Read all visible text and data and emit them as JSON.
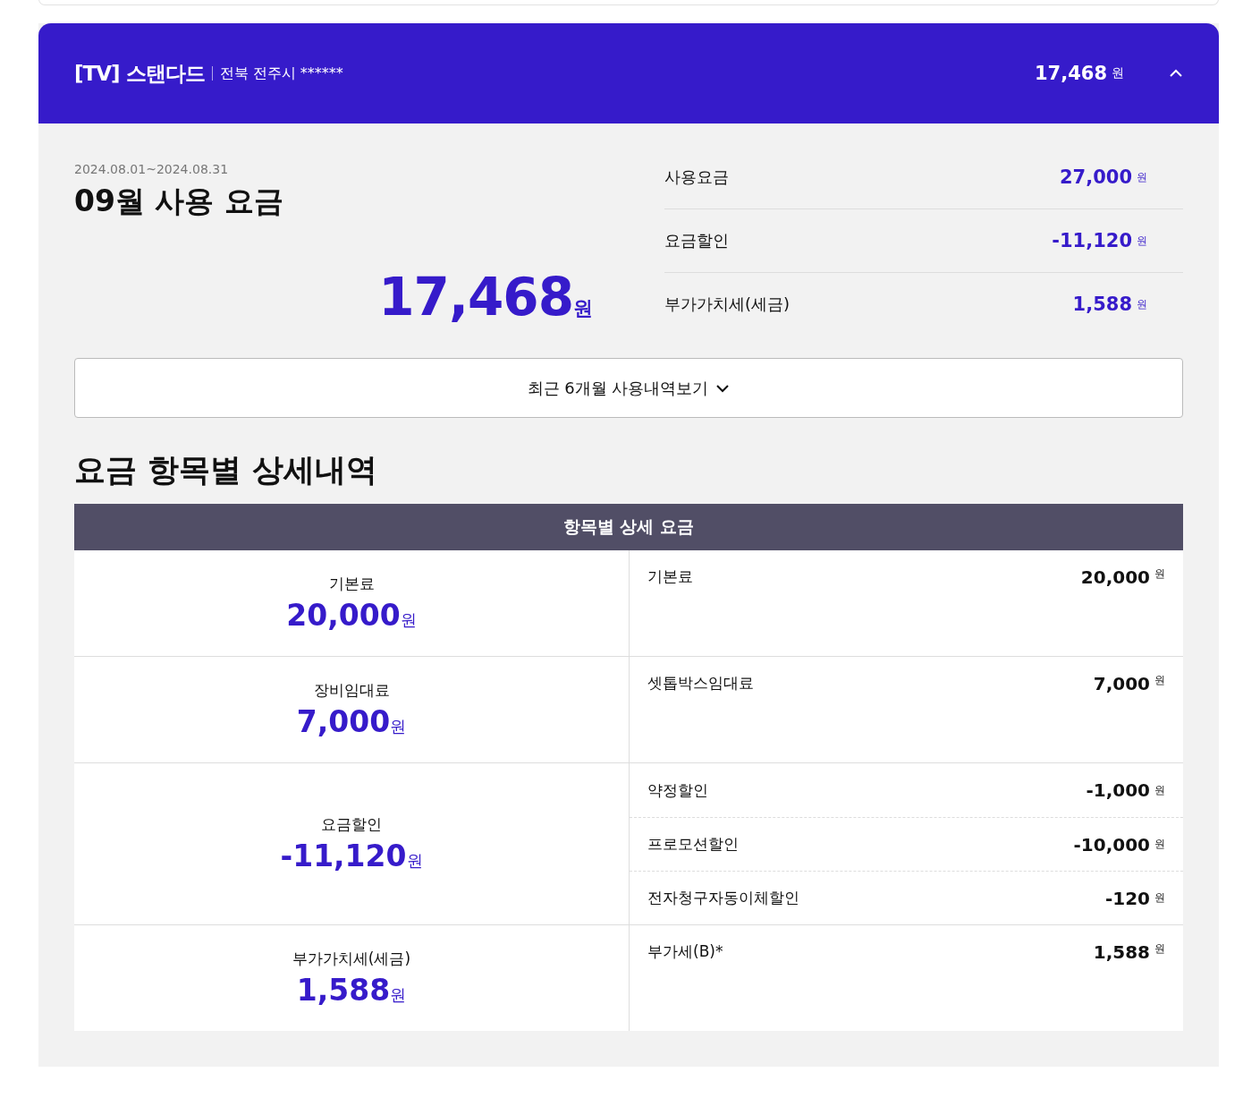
{
  "header": {
    "title": "[TV] 스탠다드",
    "address": "전북 전주시 ******",
    "total": "17,468",
    "unit": "원",
    "expanded": true
  },
  "summary": {
    "period": "2024.08.01~2024.08.31",
    "title": "09월 사용 요금",
    "total": "17,468",
    "unit": "원",
    "rows": [
      {
        "label": "사용요금",
        "value": "27,000",
        "unit": "원"
      },
      {
        "label": "요금할인",
        "value": "-11,120",
        "unit": "원"
      },
      {
        "label": "부가가치세(세금)",
        "value": "1,588",
        "unit": "원"
      }
    ]
  },
  "history_button": {
    "label": "최근 6개월 사용내역보기",
    "expanded": false
  },
  "detail": {
    "title": "요금 항목별 상세내역",
    "table_header": "항목별 상세 요금",
    "groups": [
      {
        "name": "기본료",
        "amount": "20,000",
        "unit": "원",
        "items": [
          {
            "label": "기본료",
            "amount": "20,000",
            "unit": "원"
          }
        ]
      },
      {
        "name": "장비임대료",
        "amount": "7,000",
        "unit": "원",
        "items": [
          {
            "label": "셋톱박스임대료",
            "amount": "7,000",
            "unit": "원"
          }
        ]
      },
      {
        "name": "요금할인",
        "amount": "-11,120",
        "unit": "원",
        "items": [
          {
            "label": "약정할인",
            "amount": "-1,000",
            "unit": "원"
          },
          {
            "label": "프로모션할인",
            "amount": "-10,000",
            "unit": "원"
          },
          {
            "label": "전자청구자동이체할인",
            "amount": "-120",
            "unit": "원"
          }
        ]
      },
      {
        "name": "부가가치세(세금)",
        "amount": "1,588",
        "unit": "원",
        "items": [
          {
            "label": "부가세(B)*",
            "amount": "1,588",
            "unit": "원"
          }
        ]
      }
    ]
  }
}
